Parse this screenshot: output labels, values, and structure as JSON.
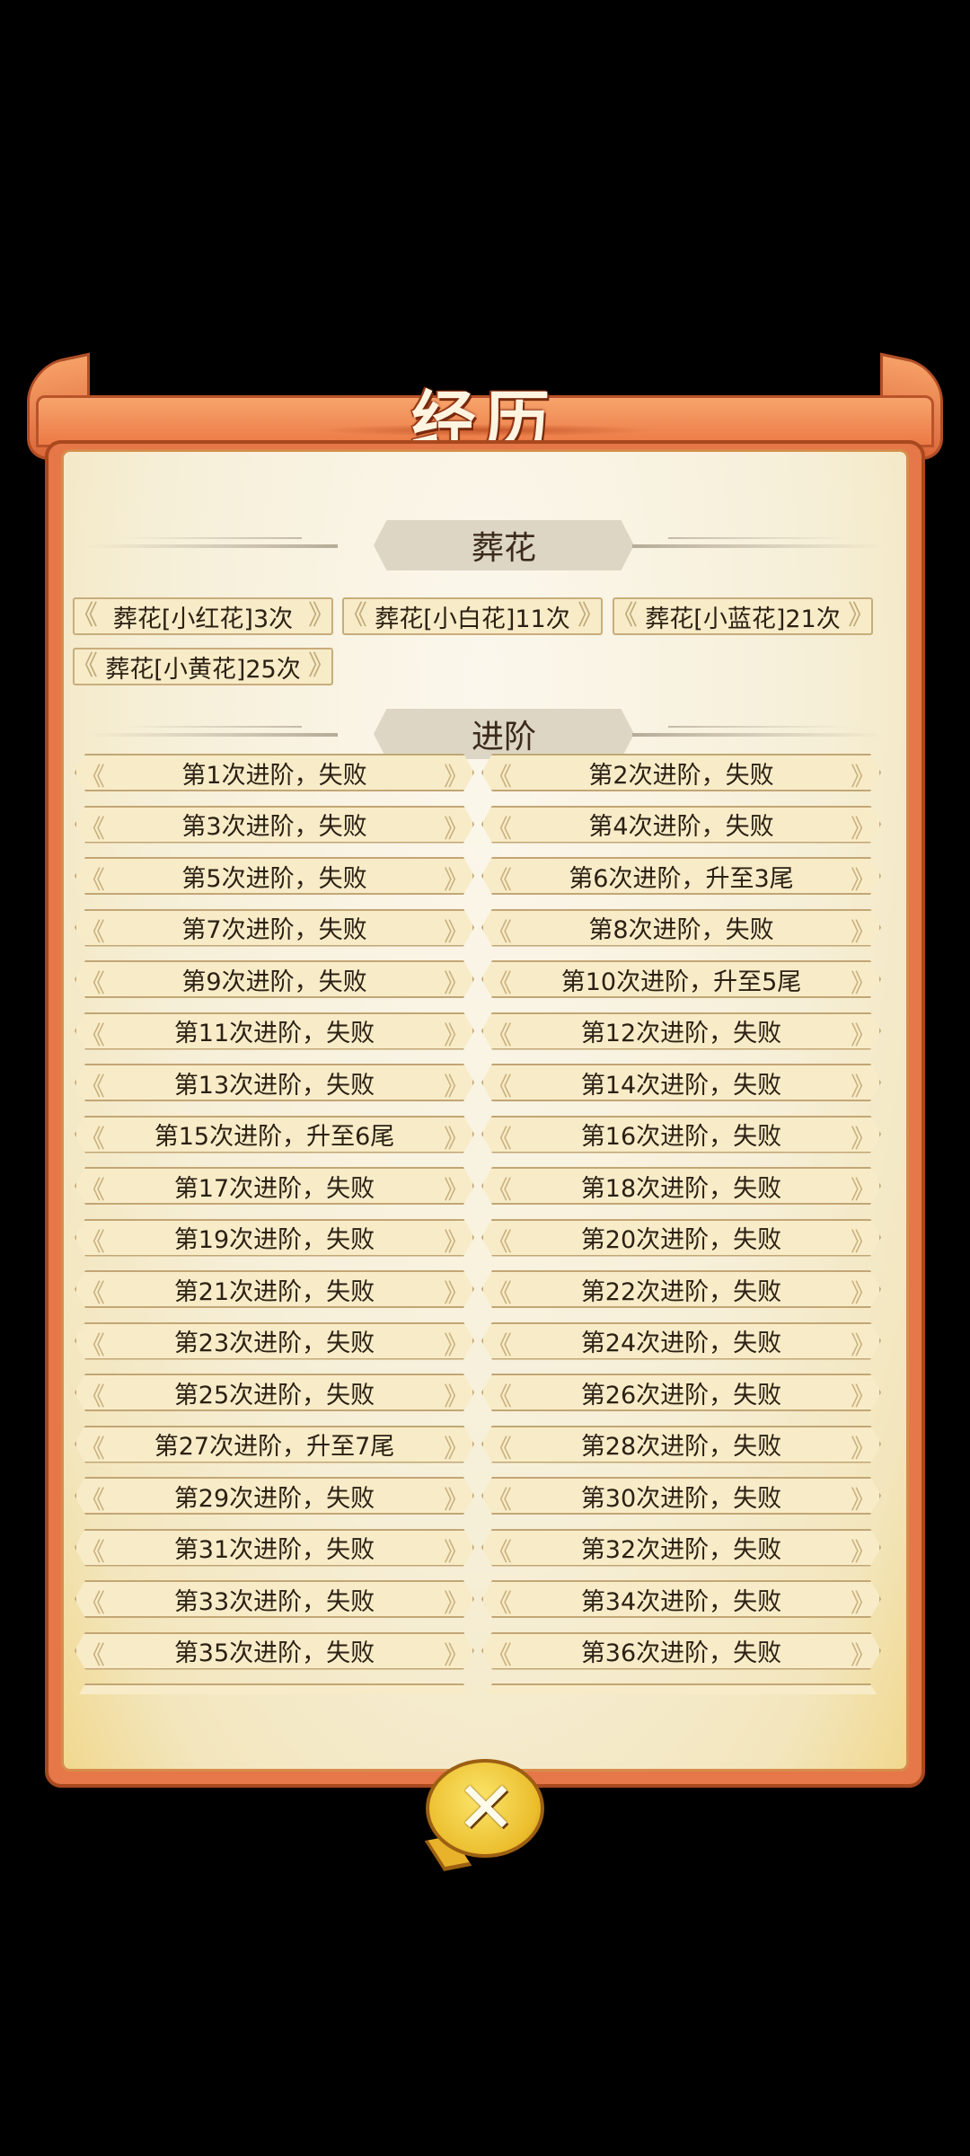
{
  "title": "经历",
  "sections": {
    "flowers": {
      "heading": "葬花",
      "tags": [
        "葬花[小红花]3次",
        "葬花[小白花]11次",
        "葬花[小蓝花]21次",
        "葬花[小黄花]25次"
      ]
    },
    "advance": {
      "heading": "进阶",
      "records": [
        "第1次进阶，失败",
        "第2次进阶，失败",
        "第3次进阶，失败",
        "第4次进阶，失败",
        "第5次进阶，失败",
        "第6次进阶，升至3尾",
        "第7次进阶，失败",
        "第8次进阶，失败",
        "第9次进阶，失败",
        "第10次进阶，升至5尾",
        "第11次进阶，失败",
        "第12次进阶，失败",
        "第13次进阶，失败",
        "第14次进阶，失败",
        "第15次进阶，升至6尾",
        "第16次进阶，失败",
        "第17次进阶，失败",
        "第18次进阶，失败",
        "第19次进阶，失败",
        "第20次进阶，失败",
        "第21次进阶，失败",
        "第22次进阶，失败",
        "第23次进阶，失败",
        "第24次进阶，失败",
        "第25次进阶，失败",
        "第26次进阶，失败",
        "第27次进阶，升至7尾",
        "第28次进阶，失败",
        "第29次进阶，失败",
        "第30次进阶，失败",
        "第31次进阶，失败",
        "第32次进阶，失败",
        "第33次进阶，失败",
        "第34次进阶，失败",
        "第35次进阶，失败",
        "第36次进阶，失败"
      ]
    }
  },
  "close_icon": "close-x-icon",
  "colors": {
    "frame": "#e57748",
    "paper": "#f6efd8",
    "tag_bg": "#f8ecc8",
    "close_button": "#ebbd2c"
  }
}
